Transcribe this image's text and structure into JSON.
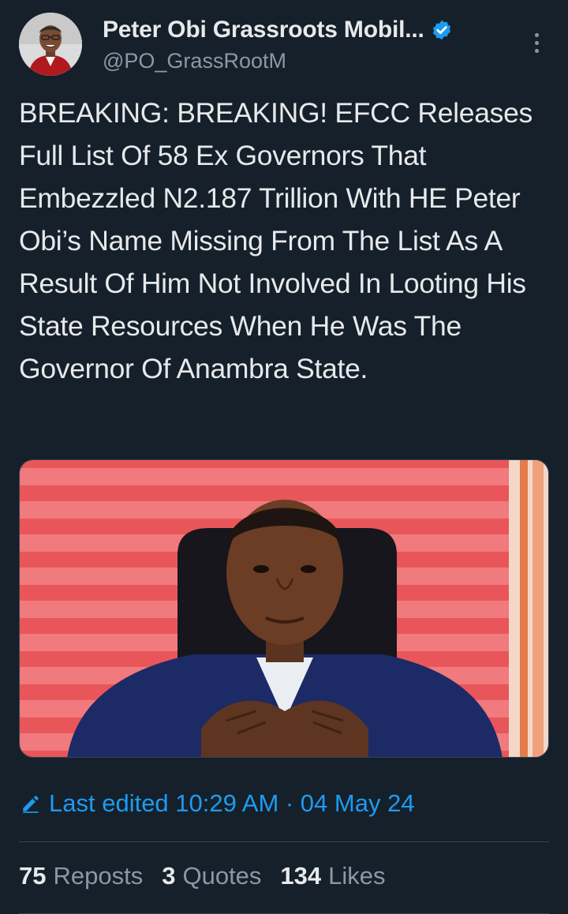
{
  "author": {
    "display_name": "Peter Obi Grassroots Mobil...",
    "handle": "@PO_GrassRootM",
    "verified": true,
    "avatar_icon": "profile-photo"
  },
  "tweet": {
    "text": "BREAKING: BREAKING! EFCC Releases Full List Of 58 Ex Governors That Embezzled N2.187 Trillion With HE Peter Obi’s Name Missing From The List As A Result Of Him Not Involved In Looting His State Resources When He Was The Governor Of Anambra State."
  },
  "edited": {
    "label": "Last edited 10:29 AM · 04 May 24",
    "icon": "pencil-icon"
  },
  "stats": {
    "reposts_count": "75",
    "reposts_label": "Reposts",
    "quotes_count": "3",
    "quotes_label": "Quotes",
    "likes_count": "134",
    "likes_label": "Likes"
  },
  "colors": {
    "background": "#15202b",
    "text": "#e7e9ea",
    "secondary": "#8b98a5",
    "accent": "#1d9bf0",
    "divider": "#38444d"
  }
}
